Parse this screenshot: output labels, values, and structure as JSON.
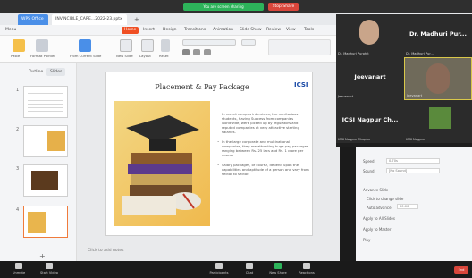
{
  "sharing": {
    "banner": "You are screen sharing",
    "stop_label": "Stop Share"
  },
  "browser": {
    "tabs": [
      {
        "label": "WPS Office"
      },
      {
        "label": "INVINCIBLE_CARE…2022-23.pptx"
      }
    ],
    "new_tab": "+"
  },
  "ribbon": {
    "menu": [
      "Menu",
      "Home",
      "Insert",
      "Design",
      "Transitions",
      "Animation",
      "Slide Show",
      "Review",
      "View",
      "Tools"
    ],
    "active": "Home",
    "tools": [
      {
        "label": "Paste",
        "icon": "paste-icon"
      },
      {
        "label": "Format Painter",
        "icon": "painter-icon"
      },
      {
        "label": "From Current Slide",
        "icon": "play-icon"
      },
      {
        "label": "New Slide",
        "icon": "new-slide-icon"
      },
      {
        "label": "Layout",
        "icon": "layout-icon"
      },
      {
        "label": "Reset",
        "icon": "reset-icon"
      },
      {
        "label": "Bold",
        "icon": "bold-icon"
      }
    ]
  },
  "left_panel": {
    "tabs": [
      "Outline",
      "Slides"
    ],
    "active_tab": "Slides",
    "slide_numbers": [
      "1",
      "2",
      "3",
      "4"
    ],
    "selected_slide": "4",
    "add_label": "+"
  },
  "slide": {
    "title": "Placement & Pay Package",
    "logo": "ICSI",
    "bullets": [
      "In recent campus interviews, the meritorious students, having Success from companies worldwide, were picked up by regulators and reputed companies at very attractive starting salaries.",
      "In the large corporate and multinational companies, they are attracting huge pay packages ranging between Rs. 25 lacs and Rs. 1 crore per annum.",
      "Salary packages, of course, depend upon the capabilities and aptitude of a person and vary from sector to sector."
    ],
    "notes_placeholder": "Click to add notes"
  },
  "video": {
    "tiles": [
      {
        "name": "Dr. Madhuri Purohit",
        "label": "",
        "type": "photo"
      },
      {
        "name": "Dr. Madhuri Pur...",
        "label": "Dr. Madhuri Pur...",
        "type": "text"
      },
      {
        "name": "Jeevanart",
        "label": "Jeevanart",
        "type": "text"
      },
      {
        "name": "Jeevanart",
        "label": "",
        "type": "photo"
      },
      {
        "name": "ICSI Nagpur Chapter",
        "label": "ICSI Nagpur Ch...",
        "type": "text"
      },
      {
        "name": "ICSI Nagpur",
        "label": "",
        "type": "photo"
      }
    ]
  },
  "settings": {
    "rows": [
      "Speed",
      "Sound",
      "Advance Slide",
      "Click to change slide",
      "Auto advance",
      "Apply to All Slides",
      "Apply to Master",
      "Play"
    ],
    "values": [
      "0.70s",
      "[No Sound]",
      "00:00"
    ]
  },
  "zoom": {
    "buttons": [
      {
        "label": "Unmute",
        "icon": "mic-icon"
      },
      {
        "label": "Start Video",
        "icon": "camera-icon"
      },
      {
        "label": "Participants",
        "icon": "participants-icon"
      },
      {
        "label": "Chat",
        "icon": "chat-icon"
      },
      {
        "label": "New Share",
        "icon": "share-icon"
      },
      {
        "label": "Reactions",
        "icon": "reactions-icon"
      }
    ],
    "end_label": "End"
  }
}
